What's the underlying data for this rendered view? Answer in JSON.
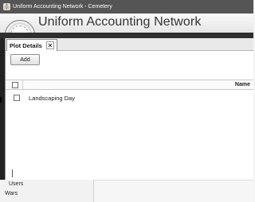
{
  "window": {
    "title": "Uniform Accounting Network - Cemetery",
    "icon": "app-icon"
  },
  "banner": {
    "brand": "Uniform Accounting Network",
    "logo_icon": "seal-logo"
  },
  "tabs": [
    {
      "label": "Plot Details",
      "close_symbol": "✕"
    }
  ],
  "toolbar": {
    "add_label": "Add"
  },
  "grid": {
    "columns": [
      "Name"
    ],
    "rows": [
      {
        "name": "Landscaping Day",
        "checked": false
      }
    ]
  },
  "nav": {
    "items": [
      "Users",
      "Wars"
    ]
  },
  "colors": {
    "titlebar": "#555555",
    "darkbar": "#2f2f2f",
    "panel": "#ffffff"
  }
}
